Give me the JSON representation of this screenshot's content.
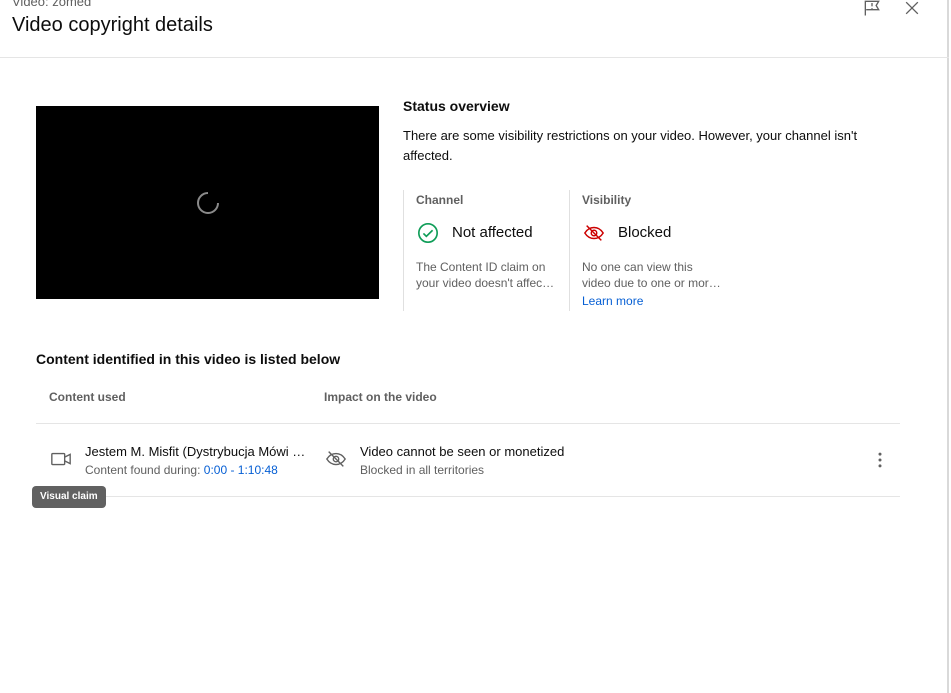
{
  "header": {
    "video_label": "Video: zomed",
    "title": "Video copyright details",
    "icons": {
      "feedback": "feedback-flag-icon",
      "close": "close-icon"
    }
  },
  "player": {
    "loading_icon": "loading-spinner-icon"
  },
  "status": {
    "title": "Status overview",
    "description": "There are some visibility restrictions on your video. However, your channel isn't affected.",
    "channel": {
      "label": "Channel",
      "value": "Not affected",
      "icon": "check-circle-icon",
      "desc_line1": "The Content ID claim on",
      "desc_line2": "your video doesn't affec…"
    },
    "visibility": {
      "label": "Visibility",
      "value": "Blocked",
      "icon": "eye-off-icon",
      "desc_line1": "No one can view this",
      "desc_line2": "video due to one or mor…",
      "learn_more": "Learn more"
    }
  },
  "content": {
    "title": "Content identified in this video is listed below",
    "columns": {
      "content_used": "Content used",
      "impact": "Impact on the video"
    },
    "rows": [
      {
        "claim_title": "Jestem M. Misfit (Dystrybucja Mówi …",
        "found_label": "Content found during:",
        "time_range": "0:00 - 1:10:48",
        "claim_type_icon": "video-camera-icon",
        "impact_icon": "eye-off-icon",
        "impact_title": "Video cannot be seen or monetized",
        "impact_sub": "Blocked in all territories"
      }
    ],
    "tooltip": "Visual claim"
  },
  "colors": {
    "accent_link": "#065fd4",
    "success_green": "#0f9d58",
    "blocked_red": "#cc0000",
    "secondary_text": "#606060"
  }
}
